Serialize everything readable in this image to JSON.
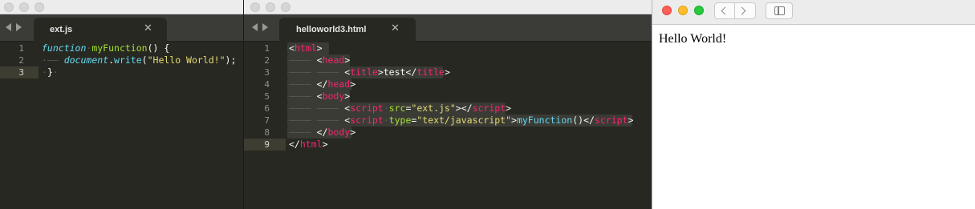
{
  "editor_left": {
    "tab_label": "ext.js",
    "close_glyph": "✕",
    "line_numbers": [
      "1",
      "2",
      "3"
    ],
    "line1": {
      "kw": "function",
      "fn": "myFunction",
      "rest": "() {"
    },
    "line2": {
      "obj": "document",
      "dot": ".",
      "method": "write",
      "open": "(",
      "str": "\"Hello World!\"",
      "close": ");"
    },
    "line3": {
      "brace": "}"
    }
  },
  "editor_right": {
    "tab_label": "helloworld3.html",
    "close_glyph": "✕",
    "line_numbers": [
      "1",
      "2",
      "3",
      "4",
      "5",
      "6",
      "7",
      "8",
      "9"
    ],
    "lines": {
      "l1": {
        "open": "<",
        "tag": "html",
        "end": ">"
      },
      "l2": {
        "open": "<",
        "tag": "head",
        "end": ">"
      },
      "l3": {
        "open": "<",
        "tag": "title",
        "end": ">",
        "text": "test",
        "close_open": "</",
        "close_tag": "title",
        "close_end": ">"
      },
      "l4": {
        "open": "</",
        "tag": "head",
        "end": ">"
      },
      "l5": {
        "open": "<",
        "tag": "body",
        "end": ">"
      },
      "l6": {
        "open": "<",
        "tag": "script",
        "attr": "src",
        "eq": "=",
        "val": "\"ext.js\"",
        "end": ">",
        "close_open": "</",
        "close_tag": "script",
        "close_end": ">"
      },
      "l7": {
        "open": "<",
        "tag": "script",
        "attr": "type",
        "eq": "=",
        "val": "\"text/javascript\"",
        "end": ">",
        "fn": "myFunction",
        "paren": "()",
        "close_open": "</",
        "close_tag": "script",
        "close_end": ">"
      },
      "l8": {
        "open": "</",
        "tag": "body",
        "end": ">"
      },
      "l9": {
        "open": "</",
        "tag": "html",
        "end": ">"
      }
    }
  },
  "browser": {
    "page_text": "Hello World!"
  },
  "icons": {
    "back": "chevron-left-icon",
    "forward": "chevron-right-icon",
    "sidebar": "sidebar-icon",
    "tab_close": "close-icon",
    "editor_nav": "nav-arrows-icon"
  },
  "colors": {
    "editor_bg": "#272822",
    "keyword": "#66d9ef",
    "function": "#a6e22e",
    "string": "#e6db74",
    "tag": "#f92672",
    "text": "#f8f8f2"
  }
}
